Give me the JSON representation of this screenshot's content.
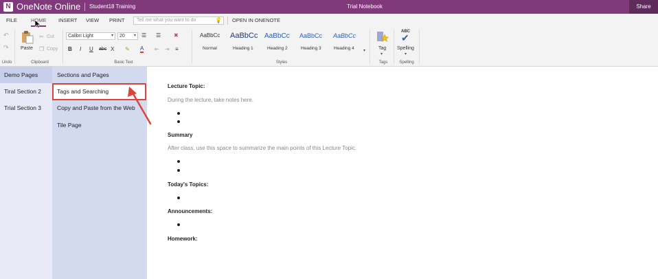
{
  "titlebar": {
    "app_name": "OneNote Online",
    "user": "Student18 Training",
    "notebook_title": "Trial Notebook",
    "share": "Share",
    "logo_letter": "N"
  },
  "menu": {
    "file": "FILE",
    "home": "HOME",
    "insert": "INSERT",
    "view": "VIEW",
    "print": "PRINT",
    "tell_me_placeholder": "Tell me what you want to do",
    "open_in_onenote": "OPEN IN ONENOTE"
  },
  "ribbon": {
    "undo_group": "Undo",
    "paste": "Paste",
    "cut": "Cut",
    "copy": "Copy",
    "clipboard_group": "Clipboard",
    "font_name": "Calibri Light",
    "font_size": "20",
    "bold": "B",
    "italic": "I",
    "underline": "U",
    "strike": "abc",
    "subscript": "X",
    "font_color": "A",
    "basic_text_group": "Basic Text",
    "styles": [
      {
        "sample": "AaBbCc",
        "name": "Normal"
      },
      {
        "sample": "AaBbCc",
        "name": "Heading 1"
      },
      {
        "sample": "AaBbCc",
        "name": "Heading 2"
      },
      {
        "sample": "AaBbCc",
        "name": "Heading 3"
      },
      {
        "sample": "AaBbCc",
        "name": "Heading 4"
      }
    ],
    "styles_group": "Styles",
    "tag": "Tag",
    "tags_group": "Tags",
    "spelling_abc": "ABC",
    "spelling": "Spelling",
    "spelling_group": "Spelling"
  },
  "sections": [
    {
      "label": "Demo Pages"
    },
    {
      "label": "Tiral Section 2"
    },
    {
      "label": "Trial Section 3"
    }
  ],
  "pages": [
    {
      "label": "Sections and Pages"
    },
    {
      "label": "Tags and Searching"
    },
    {
      "label": "Copy and Paste from the Web"
    },
    {
      "label": "Tile Page"
    }
  ],
  "content": {
    "lecture_topic": "Lecture Topic:",
    "lecture_note": "During the lecture, take notes here.",
    "summary": "Summary",
    "summary_note": "After class, use this space to summarize the main points of this Lecture Topic.",
    "todays_topics": "Today's Topics:",
    "announcements": "Announcements:",
    "homework": "Homework:"
  },
  "colors": {
    "brand": "#80397b",
    "highlight": "#d9453b",
    "section_pane": "#e8ebf7",
    "page_pane": "#d3d9ef"
  }
}
